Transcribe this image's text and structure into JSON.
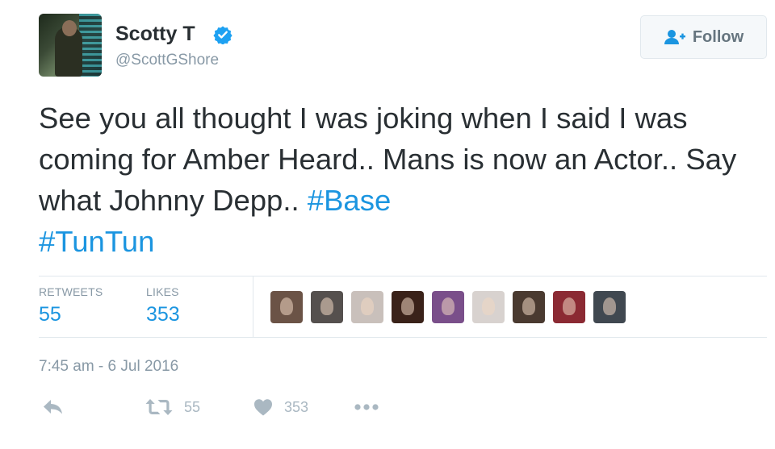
{
  "tweet": {
    "display_name": "Scotty T",
    "handle": "@ScottGShore",
    "follow_label": "Follow",
    "text_plain": "See you all thought I was joking when I said I was coming for Amber Heard.. Mans is now an Actor.. Say what Johnny Depp.. ",
    "hashtags": [
      "#Base",
      "#TunTun"
    ],
    "timestamp": "7:45 am - 6 Jul 2016"
  },
  "stats": {
    "retweets_label": "RETWEETS",
    "retweets_value": "55",
    "likes_label": "LIKES",
    "likes_value": "353"
  },
  "likers_colors": [
    "#6b5346",
    "#55504e",
    "#c9c0bb",
    "#3a2219",
    "#7a4f8a",
    "#d8d2cf",
    "#4a3a30",
    "#8b2a33",
    "#404850"
  ],
  "actions": {
    "reply_icon": "reply-icon",
    "retweet_icon": "retweet-icon",
    "retweet_count": "55",
    "like_icon": "heart-icon",
    "like_count": "353",
    "more_icon": "more-dots-icon"
  },
  "colors": {
    "link": "#1b95e0",
    "verified": "#1da1f2",
    "muted": "#8899a6",
    "text": "#292f33"
  }
}
